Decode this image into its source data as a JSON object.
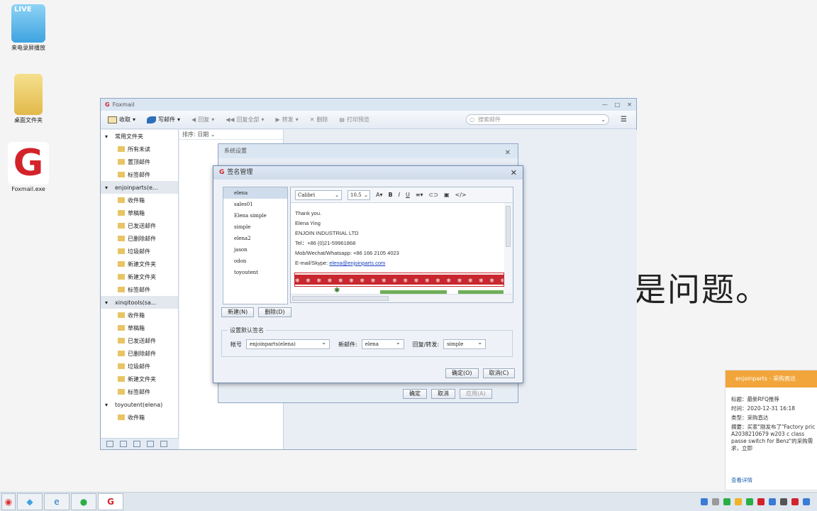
{
  "desktop": {
    "icons": [
      {
        "label": "来电录屏播放",
        "badge": "LIVE"
      },
      {
        "label": "桌面文件夹"
      },
      {
        "label": "Foxmail.exe"
      }
    ],
    "background_text": "是问题。"
  },
  "foxmail": {
    "title": "Foxmail",
    "toolbar": {
      "receive": "收取",
      "compose": "写邮件",
      "reply": "回复",
      "reply_all": "回复全部",
      "forward": "转发",
      "delete": "删除",
      "print_preview": "打印预览",
      "search_placeholder": "搜索邮件"
    },
    "list_header": "排序: 日期",
    "sidebar": [
      {
        "label": "常用文件夹",
        "level": 0
      },
      {
        "label": "所有未读",
        "level": 1
      },
      {
        "label": "置顶邮件",
        "level": 1
      },
      {
        "label": "标签邮件",
        "level": 1
      },
      {
        "label": "enjoinparts(e...",
        "level": 0,
        "account": true
      },
      {
        "label": "收件箱",
        "level": 1
      },
      {
        "label": "草稿箱",
        "level": 1
      },
      {
        "label": "已发送邮件",
        "level": 1
      },
      {
        "label": "已删除邮件",
        "level": 1
      },
      {
        "label": "垃圾邮件",
        "level": 1
      },
      {
        "label": "新建文件夹",
        "level": 1
      },
      {
        "label": "新建文件夹",
        "level": 1
      },
      {
        "label": "标签邮件",
        "level": 1
      },
      {
        "label": "xinqitools(sa...",
        "level": 0,
        "account": true
      },
      {
        "label": "收件箱",
        "level": 1
      },
      {
        "label": "草稿箱",
        "level": 1
      },
      {
        "label": "已发送邮件",
        "level": 1
      },
      {
        "label": "已删除邮件",
        "level": 1
      },
      {
        "label": "垃圾邮件",
        "level": 1
      },
      {
        "label": "新建文件夹",
        "level": 1
      },
      {
        "label": "标签邮件",
        "level": 1
      },
      {
        "label": "toyoutent(elena)",
        "level": 0
      },
      {
        "label": "收件箱",
        "level": 1
      }
    ]
  },
  "system_settings": {
    "title": "系统设置",
    "ok": "确定",
    "cancel": "取消",
    "apply": "应用(A)"
  },
  "signature": {
    "title": "签名管理",
    "names": [
      "elena",
      "sales01",
      "Elena simple",
      "simple",
      "elena2",
      "jason",
      "odon",
      "toyoutent"
    ],
    "selected": 0,
    "editor": {
      "font": "Calibri",
      "size": "10.5",
      "lines": [
        "Thank you.",
        "Elena Ying",
        "ENJOIN INDUSTRIAL LTD",
        "Tel：+86 (0)21-59961868",
        "Mob/Wechat/Whatsapp: +86 166 2105 4023"
      ],
      "email_label": "E-mail/Skype: ",
      "email": "elena@enjoinparts.com",
      "banner": "❄ ❄ ❄ ❄ ❄ ❄ ❄ ❄ ❄ ❄ ❄ ❄ ❄ ❄ ❄ ❄ ❄ ❄ ❄ ❄ ❄ ❄ ❄"
    },
    "new_btn": "新建(N)",
    "delete_btn": "删除(D)",
    "default_group": "设置默认签名",
    "account_label": "帐号",
    "account_value": "enjoinparts(elena)",
    "newmail_label": "新邮件:",
    "newmail_value": "elena",
    "reply_label": "回复/转发:",
    "reply_value": "simple",
    "ok": "确定(O)",
    "cancel": "取消(C)"
  },
  "notification": {
    "header": "enjoinparts - 采购直达",
    "subject": "标题：最新RFQ推荐",
    "time": "时间：2020-12-31 16:18",
    "type": "类型：采购直达",
    "summary": "摘要：买家\"刚发布了\"Factory pric A2038210679 w203 c class passe switch for Benz\"的采购需求，立即",
    "link": "查看详情"
  },
  "colors": {
    "accent": "#f2a53a",
    "brand_red": "#d3232a",
    "banner_red": "#c8272f"
  }
}
